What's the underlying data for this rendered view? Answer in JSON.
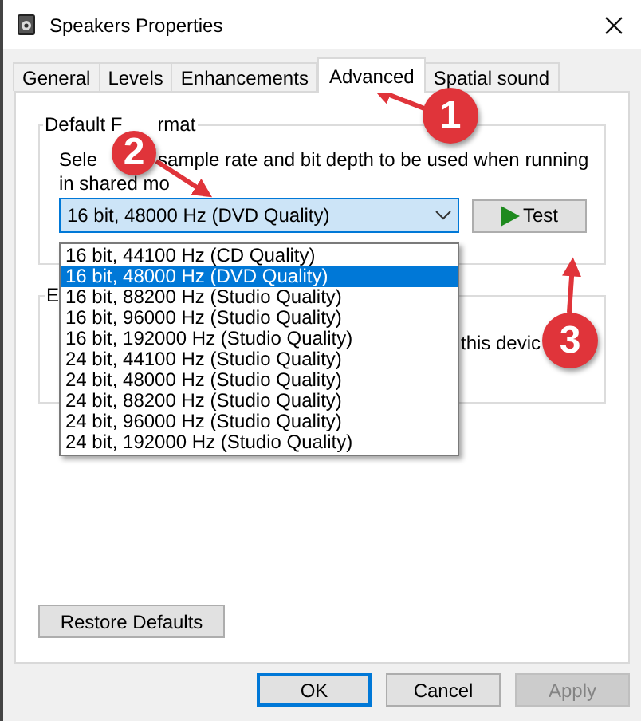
{
  "window": {
    "title": "Speakers Properties"
  },
  "tabs": [
    {
      "label": "General",
      "selected": false
    },
    {
      "label": "Levels",
      "selected": false
    },
    {
      "label": "Enhancements",
      "selected": false
    },
    {
      "label": "Advanced",
      "selected": true
    },
    {
      "label": "Spatial sound",
      "selected": false
    }
  ],
  "default_format": {
    "legend_parts": [
      "Default F",
      "rmat"
    ],
    "description_line_1": [
      "Sele",
      "sample rate and bit depth to be used when running"
    ],
    "description_line_2": "in shared mo",
    "format_dropdown": {
      "value": "16 bit, 48000 Hz (DVD Quality)",
      "expanded": true,
      "options": [
        {
          "label": "16 bit, 44100 Hz (CD Quality)",
          "selected": false
        },
        {
          "label": "16 bit, 48000 Hz (DVD Quality)",
          "selected": true
        },
        {
          "label": "16 bit, 88200 Hz (Studio Quality)",
          "selected": false
        },
        {
          "label": "16 bit, 96000 Hz (Studio Quality)",
          "selected": false
        },
        {
          "label": "16 bit, 192000 Hz (Studio Quality)",
          "selected": false
        },
        {
          "label": "24 bit, 44100 Hz (Studio Quality)",
          "selected": false
        },
        {
          "label": "24 bit, 48000 Hz (Studio Quality)",
          "selected": false
        },
        {
          "label": "24 bit, 88200 Hz (Studio Quality)",
          "selected": false
        },
        {
          "label": "24 bit, 96000 Hz (Studio Quality)",
          "selected": false
        },
        {
          "label": "24 bit, 192000 Hz (Studio Quality)",
          "selected": false
        }
      ]
    },
    "test_button": "Test"
  },
  "second_group": {
    "legend": "E",
    "text": "this devic"
  },
  "restore_button": "Restore Defaults",
  "dialog_buttons": [
    {
      "label": "OK",
      "default": true,
      "disabled": false
    },
    {
      "label": "Cancel",
      "default": false,
      "disabled": false
    },
    {
      "label": "Apply",
      "default": false,
      "disabled": true
    }
  ],
  "annotations": [
    {
      "label": "1"
    },
    {
      "label": "2"
    },
    {
      "label": "3"
    }
  ]
}
